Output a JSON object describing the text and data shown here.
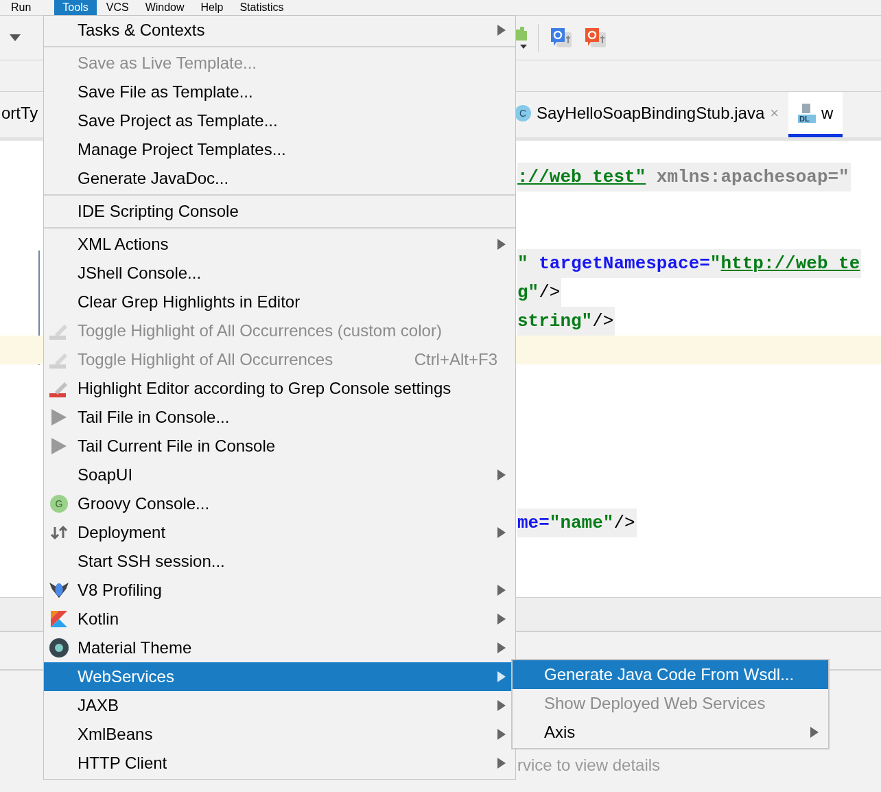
{
  "menubar": [
    {
      "label": "Run",
      "selected": false
    },
    {
      "label": "Tools",
      "selected": true
    },
    {
      "label": "VCS",
      "selected": false
    },
    {
      "label": "Window",
      "selected": false
    },
    {
      "label": "Help",
      "selected": false
    },
    {
      "label": "Statistics",
      "selected": false
    }
  ],
  "tabs": [
    {
      "label": "ortTy",
      "selected": false,
      "kind": "plain"
    },
    {
      "label": "SayHelloSoapBindingStub.java",
      "selected": false,
      "kind": "class",
      "icon_text": "C",
      "close": "×"
    },
    {
      "label": "w",
      "selected": true,
      "kind": "wsdl",
      "icon_text": "DL"
    }
  ],
  "code_lines": [
    {
      "kind": "text",
      "tokens": [
        {
          "text": "://web_test\"",
          "kind": "url"
        },
        {
          "text": " xmlns:apachesoap=\"",
          "kind": "ns"
        }
      ]
    },
    {
      "kind": "blank"
    },
    {
      "kind": "blank"
    },
    {
      "kind": "text",
      "tokens": [
        {
          "text": "\" ",
          "kind": "value"
        },
        {
          "text": "targetNamespace=",
          "kind": "attr"
        },
        {
          "text": "\"",
          "kind": "value"
        },
        {
          "text": "http://web_te",
          "kind": "url"
        }
      ]
    },
    {
      "kind": "text",
      "tokens": [
        {
          "text": "g\"",
          "kind": "value"
        },
        {
          "text": "/>",
          "kind": "plain"
        }
      ]
    },
    {
      "kind": "text",
      "tokens": [
        {
          "text": "string\"",
          "kind": "value"
        },
        {
          "text": "/>",
          "kind": "plain"
        }
      ]
    },
    {
      "kind": "caret"
    },
    {
      "kind": "blank"
    },
    {
      "kind": "blank"
    },
    {
      "kind": "blank"
    },
    {
      "kind": "blank"
    },
    {
      "kind": "blank"
    },
    {
      "kind": "text",
      "tokens": [
        {
          "text": "me=",
          "kind": "attr"
        },
        {
          "text": "\"name\"",
          "kind": "value"
        },
        {
          "text": "/>",
          "kind": "plain"
        }
      ]
    }
  ],
  "panel_hint": "rvice to view details",
  "menu": {
    "groups": [
      [
        {
          "label": "Tasks & Contexts",
          "kind": "plain",
          "submenu": true,
          "disabled": false,
          "selected": false
        }
      ],
      [
        {
          "label": "Save as Live Template...",
          "kind": "plain",
          "submenu": false,
          "disabled": true,
          "selected": false
        },
        {
          "label": "Save File as Template...",
          "kind": "plain",
          "submenu": false,
          "disabled": false,
          "selected": false
        },
        {
          "label": "Save Project as Template...",
          "kind": "plain",
          "submenu": false,
          "disabled": false,
          "selected": false
        },
        {
          "label": "Manage Project Templates...",
          "kind": "plain",
          "submenu": false,
          "disabled": false,
          "selected": false
        },
        {
          "label": "Generate JavaDoc...",
          "kind": "plain",
          "submenu": false,
          "disabled": false,
          "selected": false
        }
      ],
      [
        {
          "label": "IDE Scripting Console",
          "kind": "plain",
          "submenu": false,
          "disabled": false,
          "selected": false
        }
      ],
      [
        {
          "label": "XML Actions",
          "kind": "plain",
          "submenu": true,
          "disabled": false,
          "selected": false
        },
        {
          "label": "JShell Console...",
          "kind": "plain",
          "submenu": false,
          "disabled": false,
          "selected": false
        },
        {
          "label": "Clear Grep Highlights in Editor",
          "kind": "plain",
          "submenu": false,
          "disabled": false,
          "selected": false
        },
        {
          "label": "Toggle Highlight of All Occurrences (custom color)",
          "kind": "pencil",
          "submenu": false,
          "disabled": true,
          "selected": false
        },
        {
          "label": "Toggle Highlight of All Occurrences",
          "shortcut": "Ctrl+Alt+F3",
          "kind": "pencil",
          "submenu": false,
          "disabled": true,
          "selected": false
        },
        {
          "label": "Highlight Editor according to Grep Console settings",
          "kind": "pencil",
          "submenu": false,
          "disabled": false,
          "selected": false
        },
        {
          "label": "Tail File in Console...",
          "kind": "play",
          "submenu": false,
          "disabled": false,
          "selected": false
        },
        {
          "label": "Tail Current File in Console",
          "kind": "play",
          "submenu": false,
          "disabled": false,
          "selected": false
        },
        {
          "label": "SoapUI",
          "kind": "plain",
          "submenu": true,
          "disabled": false,
          "selected": false
        },
        {
          "label": "Groovy Console...",
          "kind": "groovy",
          "icon_text": "G",
          "submenu": false,
          "disabled": false,
          "selected": false
        },
        {
          "label": "Deployment",
          "kind": "deploy",
          "submenu": true,
          "disabled": false,
          "selected": false
        },
        {
          "label": "Start SSH session...",
          "kind": "plain",
          "submenu": false,
          "disabled": false,
          "selected": false
        },
        {
          "label": "V8 Profiling",
          "kind": "v8",
          "submenu": true,
          "disabled": false,
          "selected": false
        },
        {
          "label": "Kotlin",
          "kind": "kotlin",
          "submenu": true,
          "disabled": false,
          "selected": false
        },
        {
          "label": "Material Theme",
          "kind": "material",
          "submenu": true,
          "disabled": false,
          "selected": false
        },
        {
          "label": "WebServices",
          "kind": "plain",
          "submenu": true,
          "disabled": false,
          "selected": true
        },
        {
          "label": "JAXB",
          "kind": "plain",
          "submenu": true,
          "disabled": false,
          "selected": false
        },
        {
          "label": "XmlBeans",
          "kind": "plain",
          "submenu": true,
          "disabled": false,
          "selected": false
        },
        {
          "label": "HTTP Client",
          "kind": "plain",
          "submenu": true,
          "disabled": false,
          "selected": false
        }
      ]
    ]
  },
  "submenu": {
    "items": [
      {
        "label": "Generate Java Code From Wsdl...",
        "submenu": false,
        "disabled": false,
        "selected": true
      },
      {
        "label": "Show Deployed Web Services",
        "submenu": false,
        "disabled": true,
        "selected": false
      },
      {
        "label": "Axis",
        "submenu": true,
        "disabled": false,
        "selected": false
      }
    ]
  }
}
